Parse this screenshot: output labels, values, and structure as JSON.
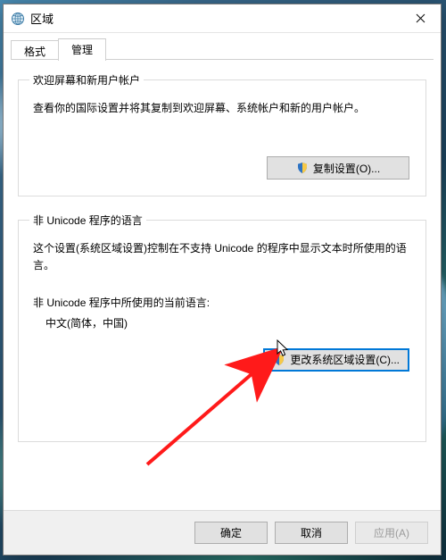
{
  "window": {
    "title": "区域"
  },
  "tabs": {
    "format": "格式",
    "admin": "管理"
  },
  "group1": {
    "legend": "欢迎屏幕和新用户帐户",
    "desc": "查看你的国际设置并将其复制到欢迎屏幕、系统帐户和新的用户帐户。",
    "copy_btn": "复制设置(O)..."
  },
  "group2": {
    "legend": "非 Unicode 程序的语言",
    "desc": "这个设置(系统区域设置)控制在不支持 Unicode 的程序中显示文本时所使用的语言。",
    "current_label": "非 Unicode 程序中所使用的当前语言:",
    "locale": "中文(简体，中国)",
    "change_btn": "更改系统区域设置(C)..."
  },
  "footer": {
    "ok": "确定",
    "cancel": "取消",
    "apply": "应用(A)"
  }
}
